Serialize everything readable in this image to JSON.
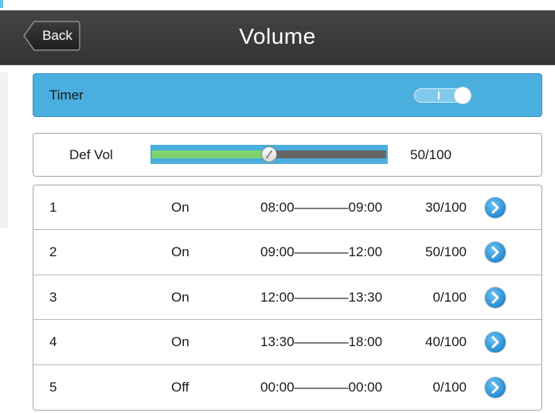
{
  "header": {
    "title": "Volume",
    "back_label": "Back"
  },
  "timer": {
    "label": "Timer",
    "enabled": true
  },
  "default_volume": {
    "label": "Def Vol",
    "value": 50,
    "max": 100,
    "value_text": "50/100"
  },
  "schedule": [
    {
      "index": "1",
      "state": "On",
      "time": "08:00————09:00",
      "volume": "30/100"
    },
    {
      "index": "2",
      "state": "On",
      "time": "09:00————12:00",
      "volume": "50/100"
    },
    {
      "index": "3",
      "state": "On",
      "time": "12:00————13:30",
      "volume": "0/100"
    },
    {
      "index": "4",
      "state": "On",
      "time": "13:30————18:00",
      "volume": "40/100"
    },
    {
      "index": "5",
      "state": "Off",
      "time": "00:00————00:00",
      "volume": "0/100"
    }
  ],
  "colors": {
    "header_bg": "#3a3a3a",
    "accent_blue": "#4aaede",
    "slider_fill": "#7fd36f",
    "slider_track": "#666666",
    "text": "#1a1a1a"
  },
  "icons": {
    "back": "back-arrow-button",
    "row_action": "chevron-right-circle-icon"
  }
}
